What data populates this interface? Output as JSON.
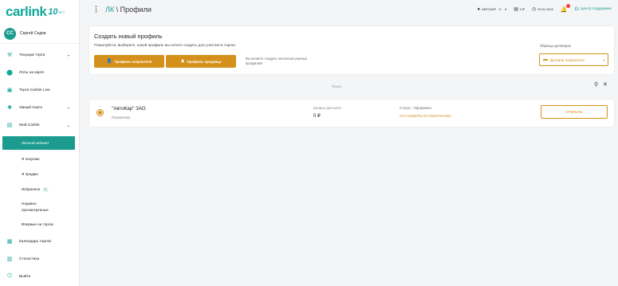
{
  "brand": {
    "logo_text": "carlink",
    "logo_years": "10",
    "logo_years_sub": "ЛЕТ"
  },
  "user": {
    "initials": "СС",
    "name": "Сергей Седов"
  },
  "sidebar": {
    "items": [
      {
        "label": "Текущие торги",
        "icon": "gavel-icon",
        "glyph": "⚒",
        "chevron": true
      },
      {
        "label": "Лоты на карте",
        "icon": "map-pin-icon",
        "glyph": "⬤",
        "chevron": false
      },
      {
        "label": "Торги Carlink Live",
        "icon": "video-icon",
        "glyph": "▣",
        "chevron": false
      },
      {
        "label": "Умный поиск",
        "icon": "bulb-icon",
        "glyph": "✺",
        "chevron": true
      },
      {
        "label": "Мой Carlink",
        "icon": "account-box-icon",
        "glyph": "▤",
        "chevron": true
      }
    ],
    "sub_items": [
      {
        "label": "Личный кабинет",
        "active": true
      },
      {
        "label": "Я покупаю"
      },
      {
        "label": "Я продаю"
      },
      {
        "label": "Избранное",
        "badge": "0"
      },
      {
        "label": "Недавно просмотренные"
      },
      {
        "label": "Впервые на торгах"
      }
    ],
    "bottom_items": [
      {
        "label": "Календарь торгов",
        "icon": "calendar-icon",
        "glyph": "▦"
      },
      {
        "label": "Статистика",
        "icon": "chart-icon",
        "glyph": "▥"
      },
      {
        "label": "Выйти",
        "icon": "power-icon",
        "glyph": "⏻"
      }
    ]
  },
  "header": {
    "breadcrumb_root": "ЛК",
    "breadcrumb_sep": " \\ ",
    "breadcrumb_current": "Профили",
    "company": "АВТОКАР",
    "company_count": "0",
    "balance": "0 ₽",
    "time": "09:31 МСК",
    "notifications": "1",
    "support": "Центр поддержки"
  },
  "create_profile": {
    "title": "Создать новый профиль",
    "description": "Пожалуйста, выберите, какой профиль вы хотите создать для участия в торгах.",
    "buyer_button": "Профиль покупателя",
    "seller_button": "Профиль продавца",
    "hint": "Вы можете создать несколько разных профилей",
    "samples_label": "Образцы договоров",
    "samples_selected": "Договор покупателя"
  },
  "search": {
    "placeholder": "Поиск"
  },
  "profiles": [
    {
      "name": "\"АвтоКар\" ЗАО",
      "type": "Покупатель",
      "deposit_label": "Баланс депозита",
      "deposit_value": "0 ₽",
      "status_label": "Статус : Оформлен",
      "set_default": "УСТАНОВИТЬ ПО УМОЛЧАНИЮ",
      "open_button": "ОТКРЫТЬ"
    }
  ],
  "colors": {
    "brand": "#1b9c8f",
    "accent": "#d4901a"
  }
}
